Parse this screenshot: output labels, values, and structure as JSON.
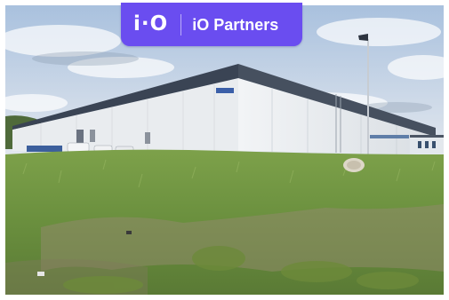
{
  "badge": {
    "logo": "i·O",
    "name": "iO Partners"
  },
  "colors": {
    "badge_background": "#6a4df0",
    "sky": "#b9cde4",
    "warehouse_wall": "#eceff2",
    "roof_band": "#3b4656",
    "grass": "#6f9442"
  }
}
